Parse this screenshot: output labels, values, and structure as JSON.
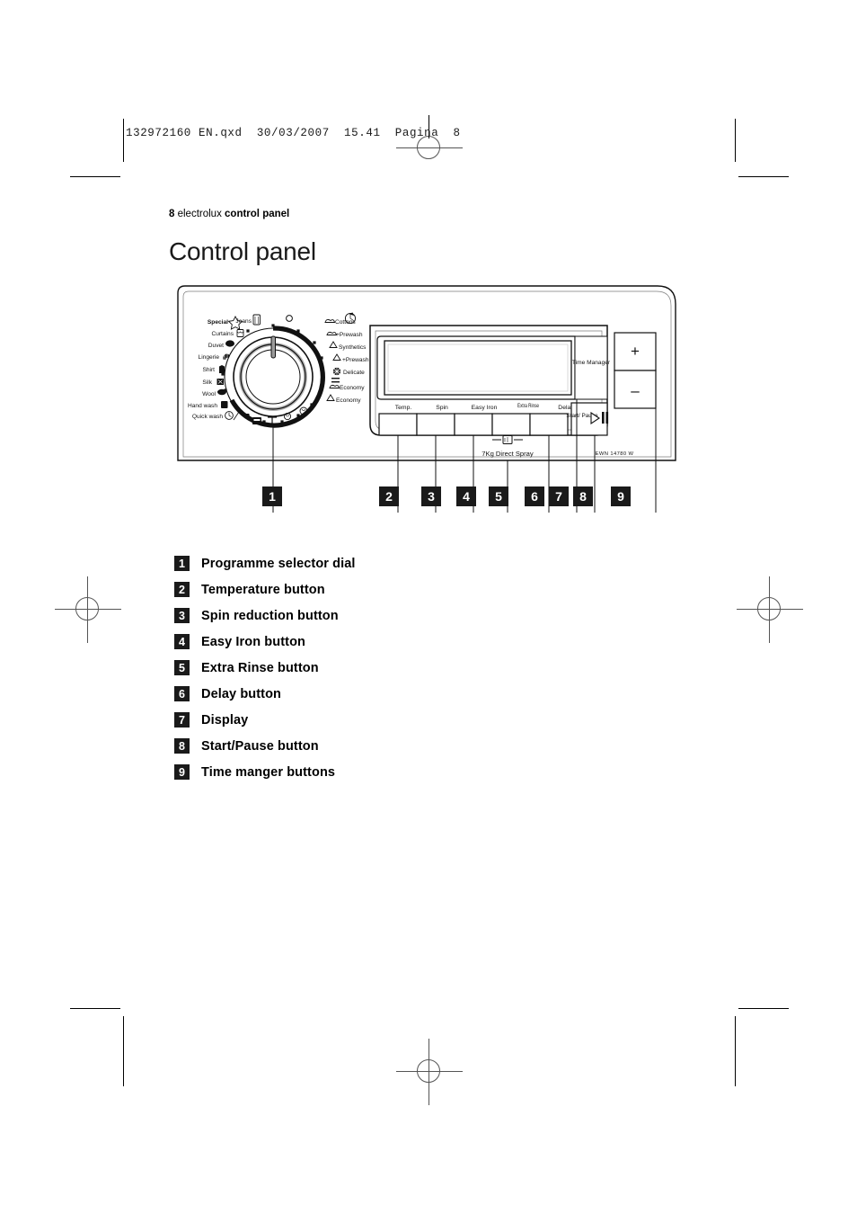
{
  "file_header": "132972160 EN.qxd  30/03/2007  15.41  Pagina  8",
  "running_head": {
    "page_number": "8",
    "brand": "electrolux",
    "section": "control panel"
  },
  "page_title": "Control panel",
  "appliance": {
    "model_code": "EWN 14780 W",
    "capacity_note": "7Kg Direct Spray",
    "display_text": "",
    "dial": {
      "left_programmes": [
        "Special",
        "Curtains",
        "Duvet",
        "Lingerie",
        "Shirt",
        "Silk",
        "Wool",
        "Hand wash",
        "Quick wash"
      ],
      "top_programme": "Jeans",
      "right_programmes": [
        "Cottons",
        "+Prewash",
        "Synthetics",
        "+Prewash",
        "Delicate",
        "Economy",
        "Economy"
      ]
    },
    "option_buttons": [
      "Temp.",
      "Spin",
      "Easy Iron",
      "Extra Rinse",
      "Delay"
    ],
    "start_pause_label": "Start/ Pause",
    "time_manager_label": "Time Manager",
    "time_manager_plus": "+",
    "time_manager_minus": "–"
  },
  "callouts": [
    "1",
    "2",
    "3",
    "4",
    "5",
    "6",
    "7",
    "8",
    "9"
  ],
  "legend": [
    {
      "num": "1",
      "label": "Programme selector dial"
    },
    {
      "num": "2",
      "label": "Temperature button"
    },
    {
      "num": "3",
      "label": "Spin reduction button"
    },
    {
      "num": "4",
      "label": "Easy Iron button"
    },
    {
      "num": "5",
      "label": "Extra Rinse button"
    },
    {
      "num": "6",
      "label": "Delay button"
    },
    {
      "num": "7",
      "label": "Display"
    },
    {
      "num": "8",
      "label": "Start/Pause button"
    },
    {
      "num": "9",
      "label": "Time manger buttons"
    }
  ]
}
